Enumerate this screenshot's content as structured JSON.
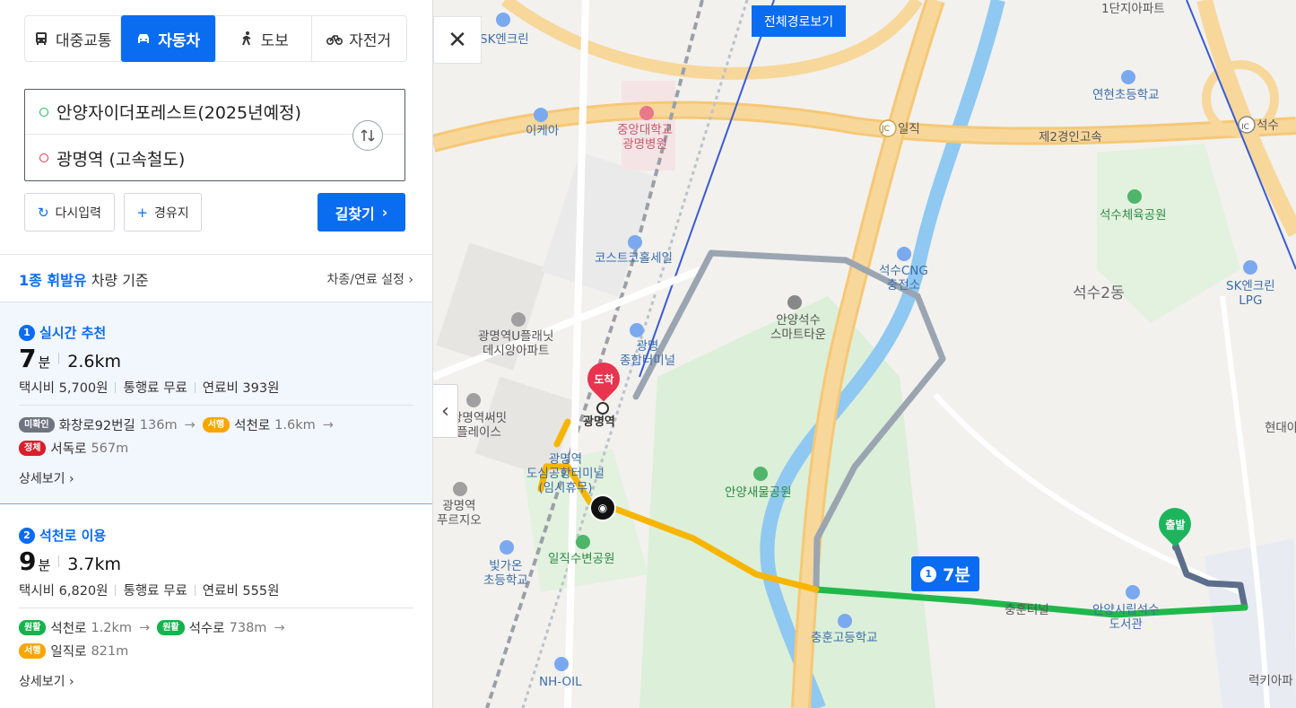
{
  "modes": [
    {
      "label": "대중교통",
      "icon": "bus-icon",
      "active": false
    },
    {
      "label": "자동차",
      "icon": "car-icon",
      "active": true
    },
    {
      "label": "도보",
      "icon": "walk-icon",
      "active": false
    },
    {
      "label": "자전거",
      "icon": "bike-icon",
      "active": false
    }
  ],
  "route": {
    "start": "안양자이더포레스트(2025년예정)",
    "goal": "광명역 (고속철도)"
  },
  "buttons": {
    "reset": "다시입력",
    "via": "경유지",
    "search": "길찾기"
  },
  "vehicle": {
    "type": "1종 휘발유",
    "suffix": "차량 기준",
    "settings": "차종/연료 설정"
  },
  "cards": [
    {
      "num": "1",
      "title": "실시간 추천",
      "minutes": "7",
      "unit": "분",
      "distance": "2.6km",
      "taxi": "택시비 5,700원",
      "toll": "통행료 무료",
      "fuel": "연료비 393원",
      "roads": [
        {
          "tag": "미확인",
          "color": "gray",
          "name": "화창로92번길",
          "len": "136m"
        },
        {
          "tag": "서행",
          "color": "orange",
          "name": "석천로",
          "len": "1.6km"
        },
        {
          "tag": "정체",
          "color": "red",
          "name": "서독로",
          "len": "567m"
        }
      ],
      "detail": "상세보기"
    },
    {
      "num": "2",
      "title": "석천로 이용",
      "minutes": "9",
      "unit": "분",
      "distance": "3.7km",
      "taxi": "택시비 6,820원",
      "toll": "통행료 무료",
      "fuel": "연료비 555원",
      "roads": [
        {
          "tag": "원활",
          "color": "green",
          "name": "석천로",
          "len": "1.2km"
        },
        {
          "tag": "원활",
          "color": "green",
          "name": "석수로",
          "len": "738m"
        },
        {
          "tag": "서행",
          "color": "orange",
          "name": "일직로",
          "len": "821m"
        }
      ],
      "detail": "상세보기"
    }
  ],
  "map": {
    "full_route": "전체경로보기",
    "end_pin": "도착",
    "start_pin": "출발",
    "bubble_num": "1",
    "bubble_time": "7분",
    "labels": {
      "sk1": "SK엔크린",
      "ikea": "이케아",
      "hospital": "중앙대학교\n광명병원",
      "costco": "코스트코홀세일",
      "upla": "광명역U플래닛\n데시앙아파트",
      "terminal": "광명\n종합터미널",
      "station": "광명역",
      "airport": "광명역\n도심공항터미널\n(임시휴무)",
      "mussit": "광명역써밋\n플레이스",
      "prugio": "광명역\n푸르지오",
      "bitgaon": "빛가온\n초등학교",
      "iljik_park": "일직수변공원",
      "saemul": "안양새물공원",
      "smarttown": "안양석수\n스마트타운",
      "cng": "석수CNG\n충전소",
      "seoksu2": "석수2동",
      "sport": "석수체육공원",
      "yeonhyeon": "연현초등학교",
      "apt1": "1단지아파트",
      "sk2": "SK엔크린\nLPG",
      "hyundai": "현대아",
      "chunghoon_school": "충훈고등학교",
      "library": "안양시립석수\n도서관",
      "chunghoon_rd": "충훈터널",
      "nh": "NH-OIL",
      "lucky": "럭키아파",
      "jc": "일직",
      "ic": "석수",
      "expressway": "제2경인고속",
      "jc_badge": "JC",
      "ic_badge": "IC"
    }
  },
  "colors": {
    "accent": "#0a6cf1",
    "start": "#1db55c",
    "end": "#e8344e",
    "route_slow": "#f7b500",
    "route_smooth": "#20b84a",
    "route_alt": "#9aa5b1"
  }
}
